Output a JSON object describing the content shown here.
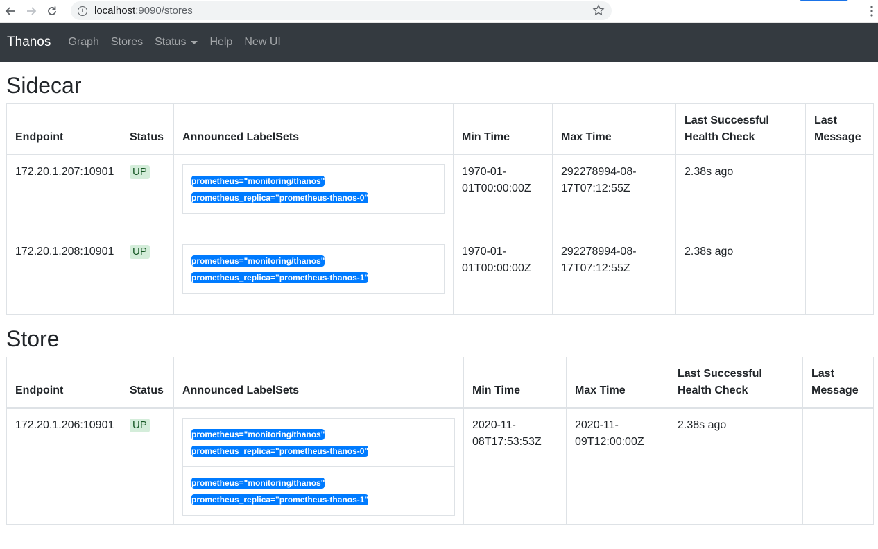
{
  "browser": {
    "url_host": "localhost",
    "url_rest": ":9090/stores"
  },
  "navbar": {
    "brand": "Thanos",
    "links": [
      "Graph",
      "Stores",
      "Status",
      "Help",
      "New UI"
    ]
  },
  "sections": [
    {
      "title": "Sidecar",
      "columns": [
        "Endpoint",
        "Status",
        "Announced LabelSets",
        "Min Time",
        "Max Time",
        "Last Successful Health Check",
        "Last Message"
      ],
      "rows": [
        {
          "endpoint": "172.20.1.207:10901",
          "status": "UP",
          "labelsets": [
            [
              "prometheus=\"monitoring/thanos\"",
              "prometheus_replica=\"prometheus-thanos-0\""
            ]
          ],
          "min_time": "1970-01-01T00:00:00Z",
          "max_time": "292278994-08-17T07:12:55Z",
          "health": "2.38s ago",
          "message": ""
        },
        {
          "endpoint": "172.20.1.208:10901",
          "status": "UP",
          "labelsets": [
            [
              "prometheus=\"monitoring/thanos\"",
              "prometheus_replica=\"prometheus-thanos-1\""
            ]
          ],
          "min_time": "1970-01-01T00:00:00Z",
          "max_time": "292278994-08-17T07:12:55Z",
          "health": "2.38s ago",
          "message": ""
        }
      ]
    },
    {
      "title": "Store",
      "columns": [
        "Endpoint",
        "Status",
        "Announced LabelSets",
        "Min Time",
        "Max Time",
        "Last Successful Health Check",
        "Last Message"
      ],
      "rows": [
        {
          "endpoint": "172.20.1.206:10901",
          "status": "UP",
          "labelsets": [
            [
              "prometheus=\"monitoring/thanos\"",
              "prometheus_replica=\"prometheus-thanos-0\""
            ],
            [
              "prometheus=\"monitoring/thanos\"",
              "prometheus_replica=\"prometheus-thanos-1\""
            ]
          ],
          "min_time": "2020-11-08T17:53:53Z",
          "max_time": "2020-11-09T12:00:00Z",
          "health": "2.38s ago",
          "message": ""
        }
      ]
    }
  ]
}
